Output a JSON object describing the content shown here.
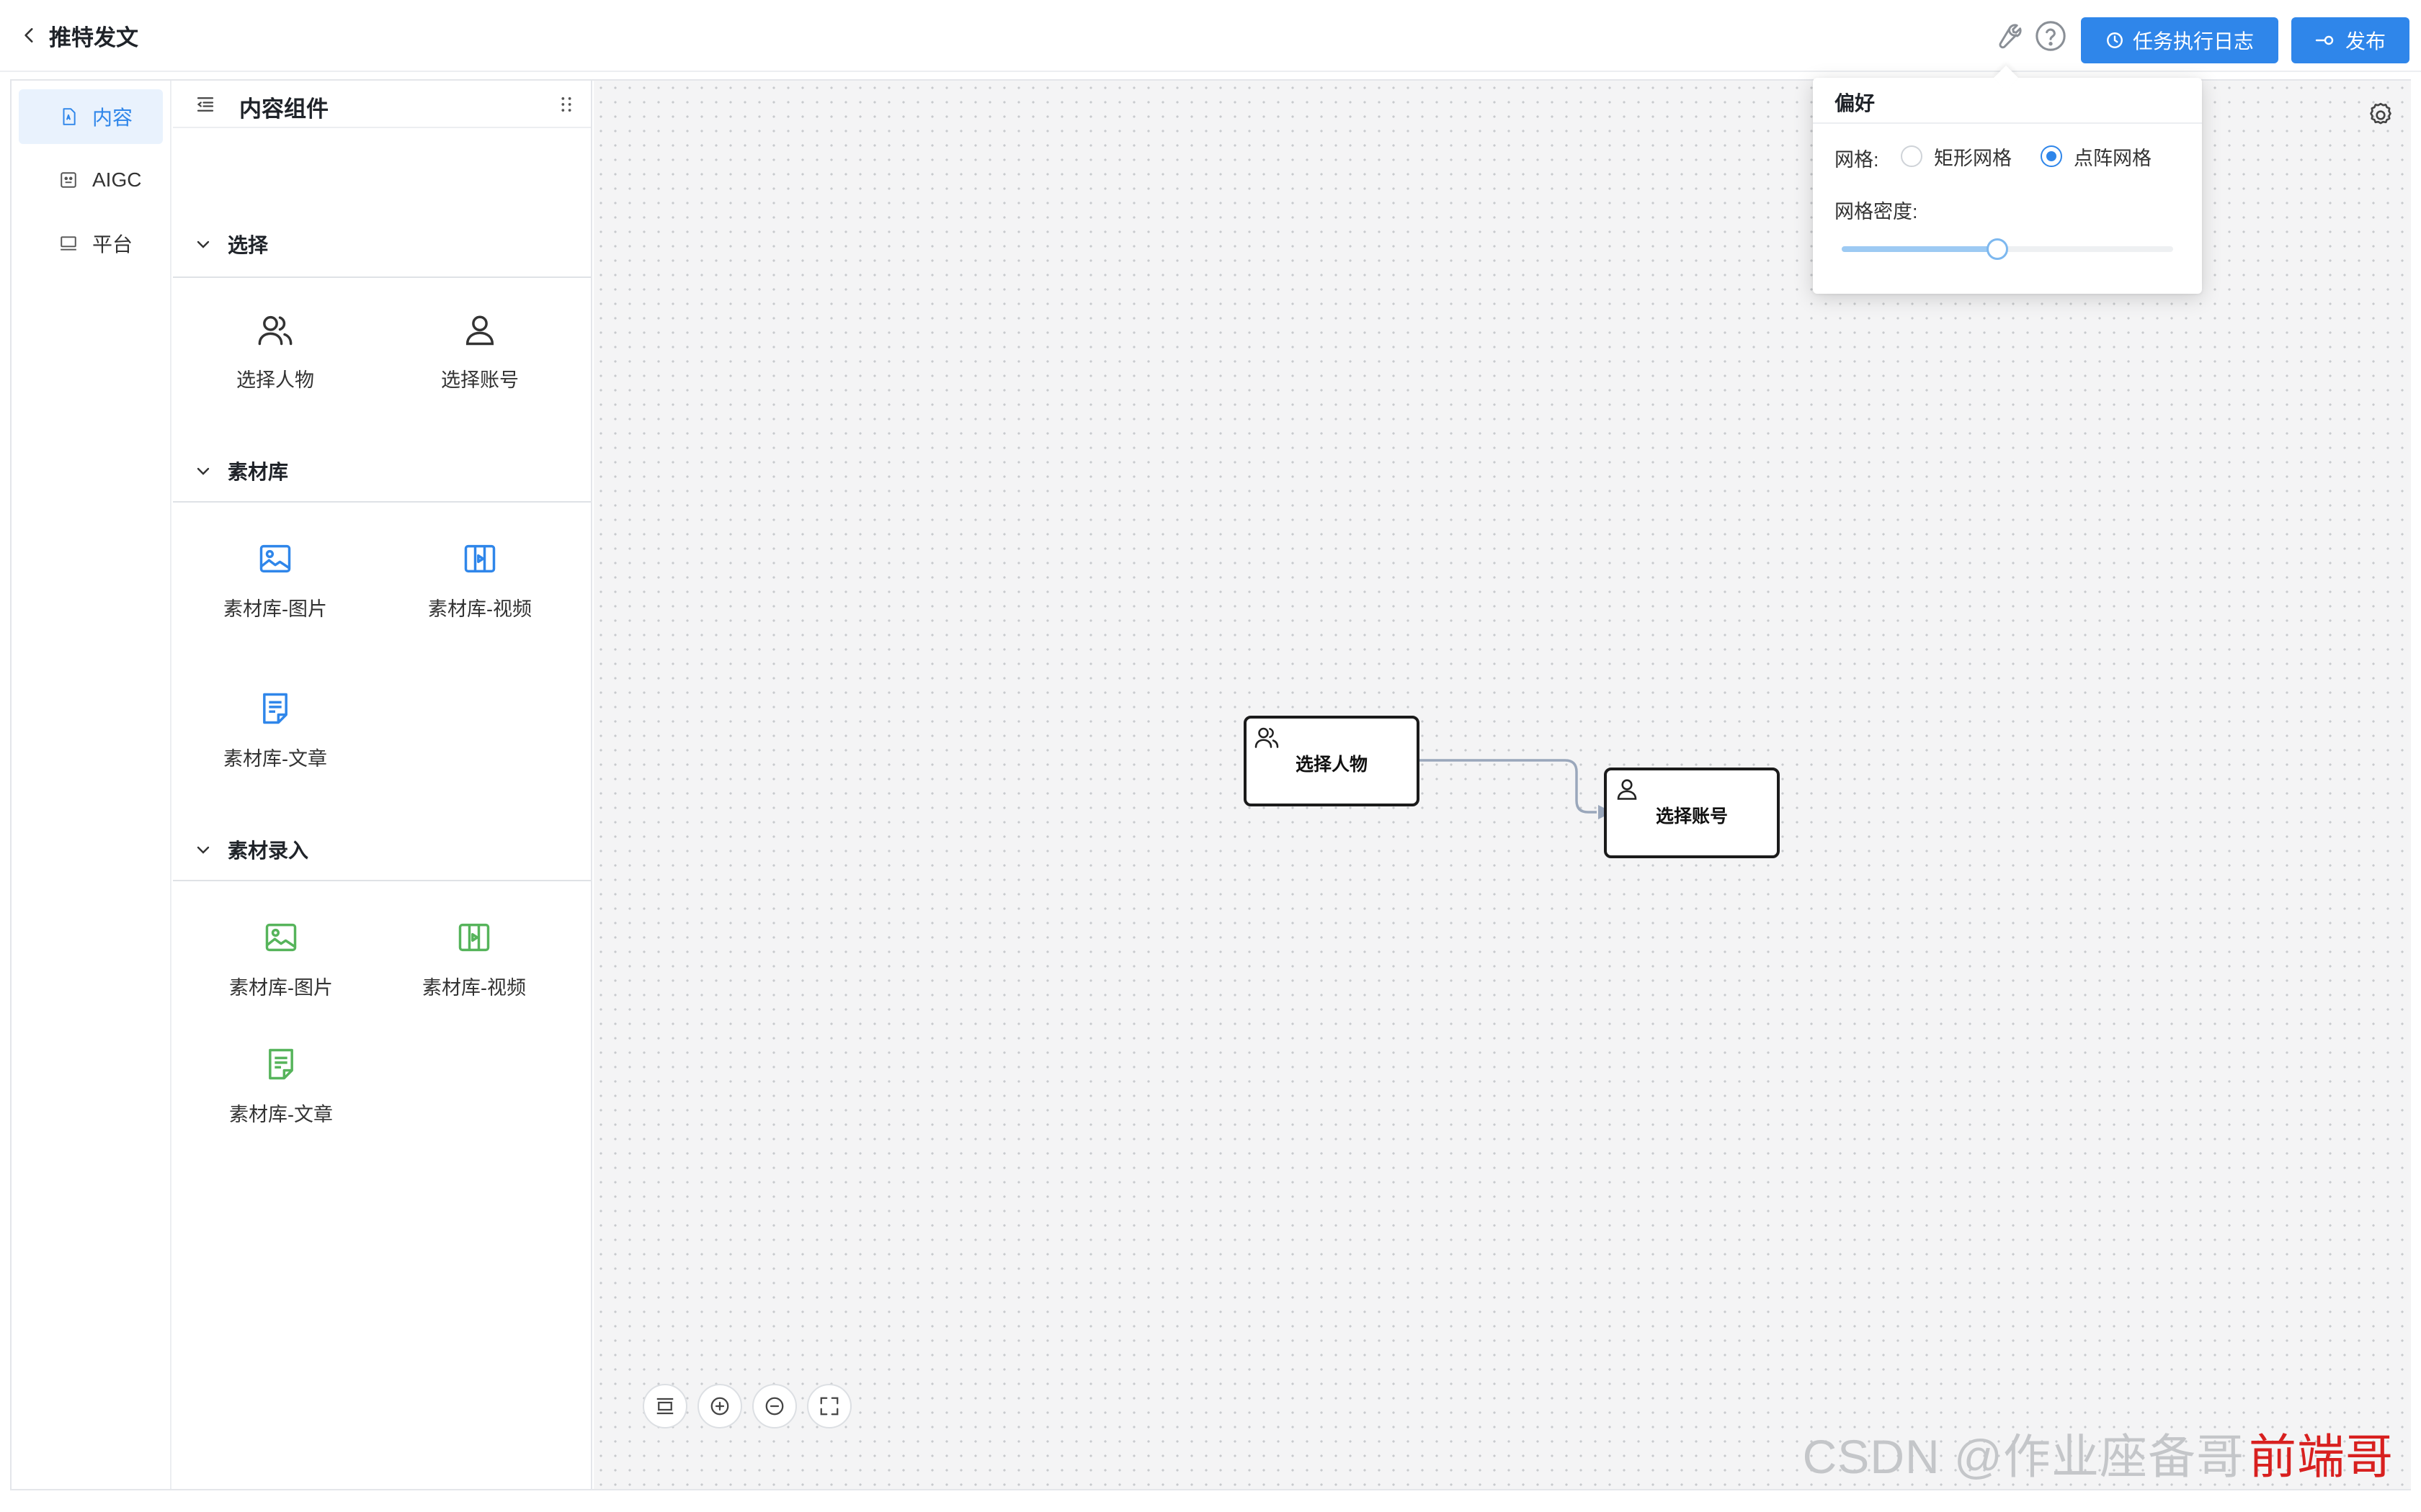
{
  "header": {
    "title": "推特发文",
    "log_button": "任务执行日志",
    "publish_button": "发布",
    "accent_color": "#2f86ea"
  },
  "rail": {
    "items": [
      {
        "label": "内容",
        "icon": "document-icon",
        "active": true
      },
      {
        "label": "AIGC",
        "icon": "robot-icon",
        "active": false
      },
      {
        "label": "平台",
        "icon": "monitor-icon",
        "active": false
      }
    ]
  },
  "panel": {
    "title": "内容组件",
    "groups": [
      {
        "title": "选择",
        "items": [
          {
            "label": "选择人物",
            "icon": "users-icon"
          },
          {
            "label": "选择账号",
            "icon": "user-icon"
          }
        ]
      },
      {
        "title": "素材库",
        "items": [
          {
            "label": "素材库-图片",
            "icon": "image-icon"
          },
          {
            "label": "素材库-视频",
            "icon": "video-icon"
          },
          {
            "label": "素材库-文章",
            "icon": "article-icon"
          }
        ]
      },
      {
        "title": "素材录入",
        "items": [
          {
            "label": "素材库-图片",
            "icon": "image-icon"
          },
          {
            "label": "素材库-视频",
            "icon": "video-icon"
          },
          {
            "label": "素材库-文章",
            "icon": "article-icon"
          }
        ]
      }
    ]
  },
  "canvas": {
    "nodes": [
      {
        "label": "选择人物",
        "icon": "users-icon"
      },
      {
        "label": "选择账号",
        "icon": "user-icon"
      }
    ],
    "watermark": "CSDN @作业座备哥",
    "watermark_overlay": "前端哥"
  },
  "preferences": {
    "title": "偏好",
    "grid_label": "网格:",
    "grid_options": [
      "矩形网格",
      "点阵网格"
    ],
    "grid_selected": "点阵网格",
    "density_label": "网格密度:",
    "density_value": 0.47
  }
}
